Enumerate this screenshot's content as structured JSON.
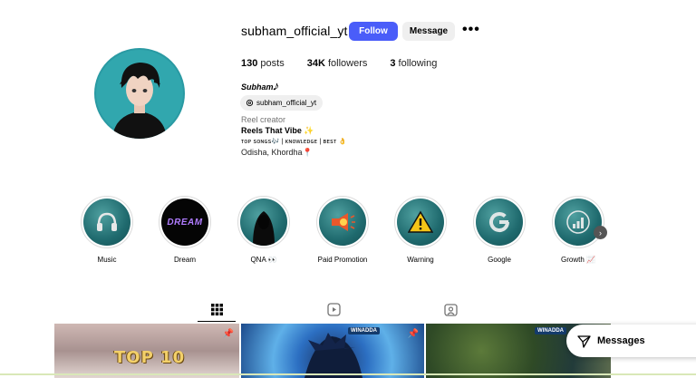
{
  "header": {
    "username": "subham_official_yt",
    "follow_label": "Follow",
    "message_label": "Message",
    "more_label": "•••"
  },
  "stats": {
    "posts_count": "130",
    "posts_label": " posts",
    "followers_count": "34K",
    "followers_label": " followers",
    "following_count": "3",
    "following_label": " following"
  },
  "profile": {
    "full_name": "Subham𝅘𝅥𝅮",
    "threads_handle": "subham_official_yt",
    "category": "Reel creator",
    "bio_line1": "Reels That Vibe ✨",
    "bio_line2": "ᴛᴏᴘ ꜱᴏɴɢꜱ🎶 | ᴋɴᴏᴡʟᴇᴅɢᴇ | ʙᴇꜱᴛ 👌",
    "bio_line3": "Odisha, Khordha📍"
  },
  "highlights": [
    {
      "label": "Music",
      "icon": "headphones-icon"
    },
    {
      "label": "Dream",
      "icon": "dream-logo"
    },
    {
      "label": "QNA 👀",
      "icon": "hooded-figure"
    },
    {
      "label": "Paid Promotion",
      "icon": "megaphone-icon"
    },
    {
      "label": "Warning",
      "icon": "warning-icon"
    },
    {
      "label": "Google",
      "icon": "google-icon"
    },
    {
      "label": "Growth 📈",
      "icon": "growth-chart-icon"
    }
  ],
  "tabs": [
    "grid-icon",
    "reels-icon",
    "tagged-icon"
  ],
  "posts": [
    {
      "text": "TOP 10"
    },
    {
      "badge": "WINADDA"
    },
    {
      "badge": "WINADDA"
    }
  ],
  "messages_label": "Messages",
  "colors": {
    "accent": "#4a5df9",
    "highlight_bg": "#1f6a6e"
  }
}
